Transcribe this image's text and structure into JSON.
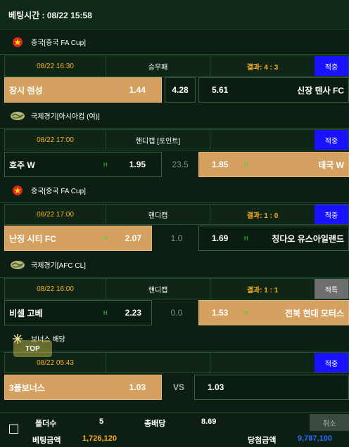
{
  "header": {
    "bet_time": "베팅시간 : 08/22 15:58"
  },
  "bets": [
    {
      "league": "중국[중국 FA Cup]",
      "league_icon": "china-flag-icon",
      "date": "08/22 16:30",
      "bet_type": "승무패",
      "result": "결과: 4 : 3",
      "status": "적중",
      "home": "장시 렌성",
      "home_odd": "1.44",
      "mid": "4.28",
      "away_odd": "5.61",
      "away": "신장 텐사 FC"
    },
    {
      "league": "국제경기[아시아컵 (여)]",
      "league_icon": "world-icon",
      "date": "08/22 17:00",
      "bet_type": "핸디캡 [포인트]",
      "result": "",
      "status": "적중",
      "home": "호주 W",
      "home_h": "H",
      "home_odd": "1.95",
      "mid": "23.5",
      "away_odd": "1.85",
      "away_h": "H",
      "away": "태국 W"
    },
    {
      "league": "중국[중국 FA Cup]",
      "league_icon": "china-flag-icon",
      "date": "08/22 17:00",
      "bet_type": "핸디캡",
      "result": "결과: 1 : 0",
      "status": "적중",
      "home": "난징 시티 FC",
      "home_h": "H",
      "home_odd": "2.07",
      "mid": "1.0",
      "away_odd": "1.69",
      "away_h": "H",
      "away": "칭다오 유스아일랜드"
    },
    {
      "league": "국제경기[AFC CL]",
      "league_icon": "world-icon",
      "date": "08/22 16:00",
      "bet_type": "핸디캡",
      "result": "결과: 1 : 1",
      "status": "적특",
      "home": "비셀 고베",
      "home_h": "H",
      "home_odd": "2.23",
      "mid": "0.0",
      "away_odd": "1.53",
      "away_h": "H",
      "away": "전북 현대 모터스"
    },
    {
      "league": "보너스 배당",
      "league_icon": "bonus-icon",
      "date": "08/22 05:43",
      "bet_type": "",
      "result": "",
      "status": "적중",
      "home": "3폴보너스",
      "home_odd": "1.03",
      "mid": "VS",
      "away_odd": "1.03",
      "away": ""
    }
  ],
  "top_button": "TOP",
  "footer": {
    "folders_label": "폴더수",
    "folders_value": "5",
    "total_odds_label": "총배당",
    "total_odds_value": "8.69",
    "cancel_label": "취소",
    "bet_amount_label": "베팅금액",
    "bet_amount_value": "1,726,120",
    "win_amount_label": "당첨금액",
    "win_amount_value": "9,787,100"
  },
  "colors": {
    "background": "#0c1f12",
    "accent_orange": "#ffae1a",
    "selected_odd": "#d4a160",
    "status_blue": "#1a12ff",
    "status_gray": "#6e6e6e",
    "handicap_green": "#2fdc2f",
    "win_blue": "#2a6bff"
  }
}
